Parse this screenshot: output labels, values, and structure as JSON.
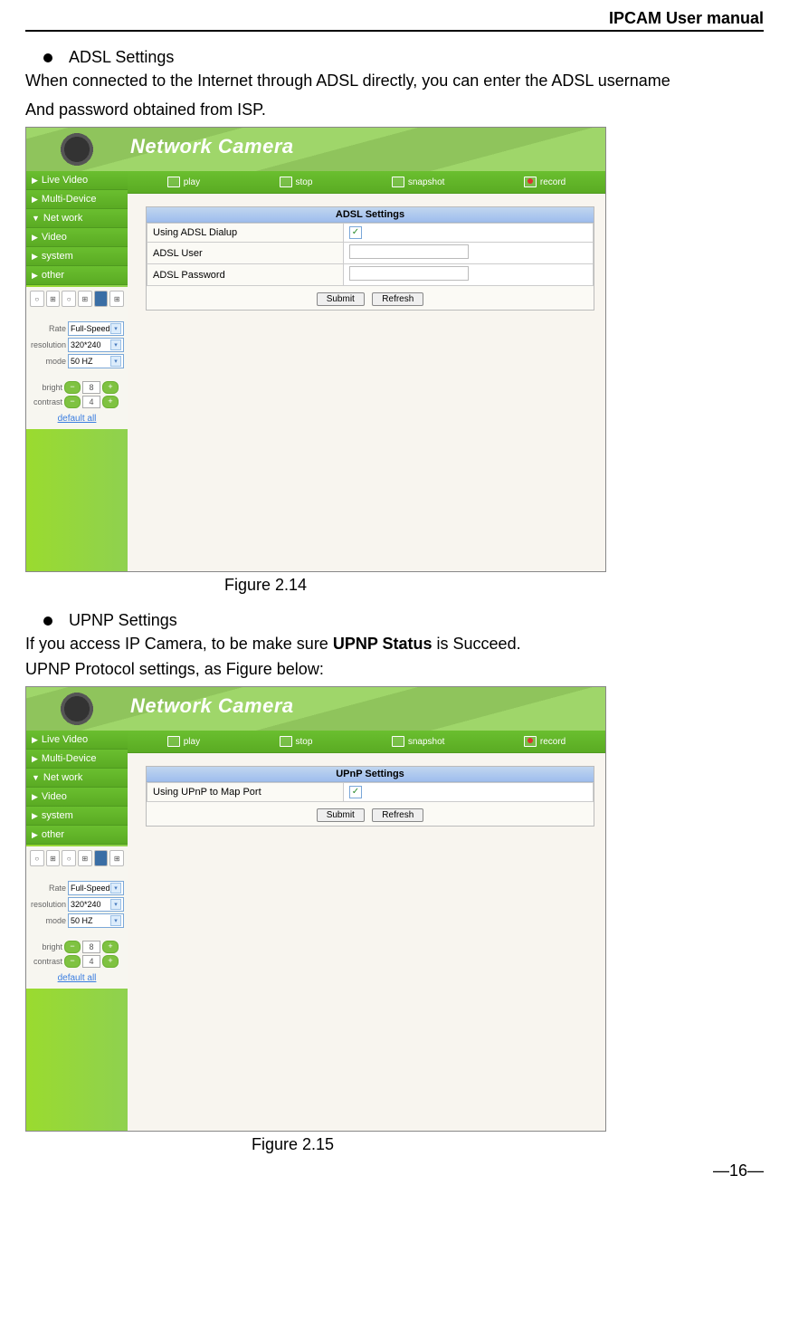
{
  "header": {
    "title": "IPCAM User manual"
  },
  "section1": {
    "bullet": "ADSL Settings",
    "desc1": "When connected to the Internet through ADSL directly, you can enter the ADSL username",
    "desc2": "And password obtained from ISP."
  },
  "app": {
    "title": "Network Camera",
    "toolbar": {
      "play": "play",
      "stop": "stop",
      "snapshot": "snapshot",
      "record": "record"
    },
    "nav": {
      "live": "Live Video",
      "multi": "Multi-Device",
      "network": "Net work",
      "video": "Video",
      "system": "system",
      "other": "other"
    },
    "controls": {
      "rate_label": "Rate",
      "rate_value": "Full-Speed",
      "resolution_label": "resolution",
      "resolution_value": "320*240",
      "mode_label": "mode",
      "mode_value": "50 HZ",
      "bright_label": "bright",
      "bright_value": "8",
      "contrast_label": "contrast",
      "contrast_value": "4",
      "default": "default all"
    },
    "adsl_panel": {
      "title": "ADSL Settings",
      "row1": "Using ADSL Dialup",
      "row2": "ADSL User",
      "row3": "ADSL Password",
      "submit": "Submit",
      "refresh": "Refresh",
      "checked": true
    },
    "upnp_panel": {
      "title": "UPnP Settings",
      "row1": "Using UPnP to Map Port",
      "submit": "Submit",
      "refresh": "Refresh",
      "checked": true
    }
  },
  "caption1": "Figure 2.14",
  "section2": {
    "bullet": "UPNP Settings",
    "desc1a": "If you access IP Camera, to be make sure ",
    "desc1b": "UPNP Status",
    "desc1c": " is Succeed.",
    "desc2": "UPNP Protocol settings, as Figure below:"
  },
  "caption2": "Figure 2.15",
  "footer": {
    "page": "—16—"
  }
}
